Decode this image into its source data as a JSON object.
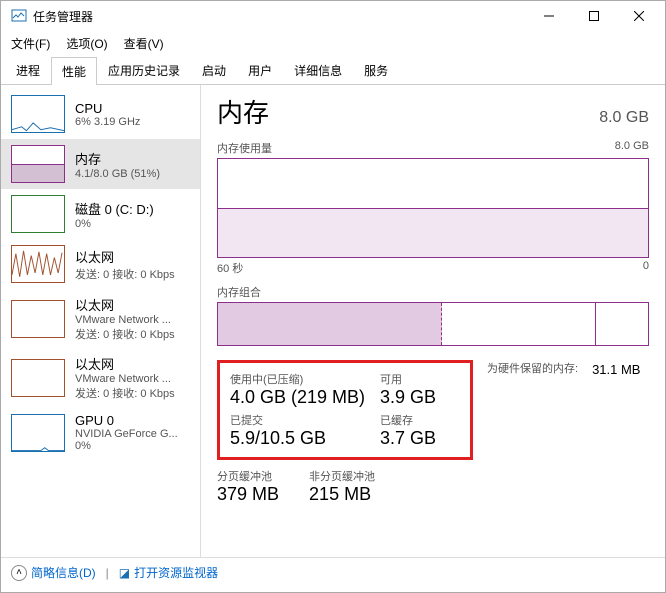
{
  "titlebar": {
    "title": "任务管理器"
  },
  "menubar": {
    "file": "文件(F)",
    "options": "选项(O)",
    "view": "查看(V)"
  },
  "tabs": [
    "进程",
    "性能",
    "应用历史记录",
    "启动",
    "用户",
    "详细信息",
    "服务"
  ],
  "active_tab": "性能",
  "sidebar": [
    {
      "title": "CPU",
      "sub": "6%  3.19 GHz",
      "kind": "cpu"
    },
    {
      "title": "内存",
      "sub": "4.1/8.0 GB (51%)",
      "kind": "mem",
      "selected": true
    },
    {
      "title": "磁盘 0 (C: D:)",
      "sub": "0%",
      "kind": "disk"
    },
    {
      "title": "以太网",
      "sub": "发送: 0 接收: 0 Kbps",
      "kind": "eth1"
    },
    {
      "title": "以太网",
      "sub_line1": "VMware Network ...",
      "sub_line2": "发送: 0 接收: 0 Kbps",
      "kind": "eth2"
    },
    {
      "title": "以太网",
      "sub_line1": "VMware Network ...",
      "sub_line2": "发送: 0 接收: 0 Kbps",
      "kind": "eth3"
    },
    {
      "title": "GPU 0",
      "sub_line1": "NVIDIA GeForce G...",
      "sub_line2": "0%",
      "kind": "gpu"
    }
  ],
  "main": {
    "title": "内存",
    "total": "8.0 GB",
    "usage_label": "内存使用量",
    "usage_max": "8.0 GB",
    "x_left": "60 秒",
    "x_right": "0",
    "comp_label": "内存组合",
    "stats": {
      "in_use_label": "使用中(已压缩)",
      "in_use_value": "4.0 GB (219 MB)",
      "avail_label": "可用",
      "avail_value": "3.9 GB",
      "committed_label": "已提交",
      "committed_value": "5.9/10.5 GB",
      "cached_label": "已缓存",
      "cached_value": "3.7 GB",
      "hw_reserved_label": "为硬件保留的内存:",
      "hw_reserved_value": "31.1 MB",
      "paged_label": "分页缓冲池",
      "paged_value": "379 MB",
      "nonpaged_label": "非分页缓冲池",
      "nonpaged_value": "215 MB"
    }
  },
  "footer": {
    "brief": "简略信息(D)",
    "monitor": "打开资源监视器"
  },
  "chart_data": {
    "type": "area",
    "title": "内存使用量",
    "xlabel": "60 秒",
    "xrange": [
      60,
      0
    ],
    "ylabel": "",
    "ylim": [
      0,
      8.0
    ],
    "yunit": "GB",
    "series": [
      {
        "name": "内存",
        "values_approx": 4.1
      }
    ]
  }
}
